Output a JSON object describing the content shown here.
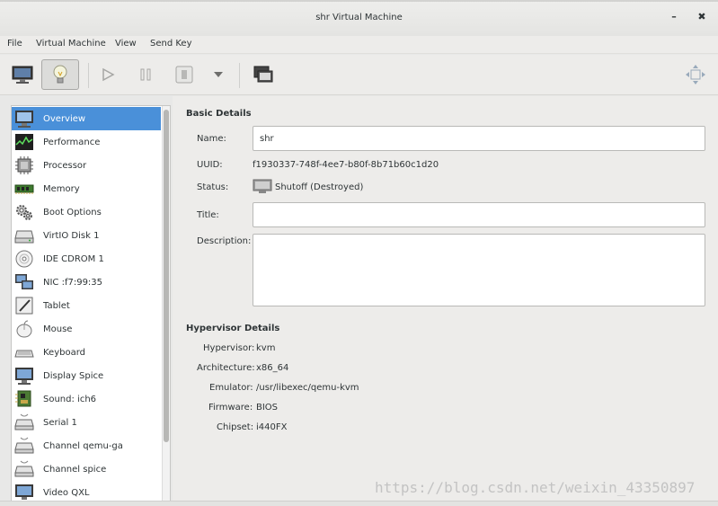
{
  "window": {
    "title": "shr Virtual Machine",
    "minimize_glyph": "–",
    "close_glyph": "✖"
  },
  "menu": [
    "File",
    "Virtual Machine",
    "View",
    "Send Key"
  ],
  "toolbar": {
    "buttons": [
      "console-monitor-icon",
      "details-lightbulb-icon",
      "run-play-icon",
      "pause-icon",
      "shutdown-icon",
      "shutdown-dropdown-icon",
      "snapshots-icon",
      "fullscreen-resize-icon"
    ]
  },
  "sidebar": {
    "items": [
      {
        "label": "Overview",
        "icon": "overview-monitor-icon",
        "selected": true
      },
      {
        "label": "Performance",
        "icon": "performance-graph-icon"
      },
      {
        "label": "Processor",
        "icon": "processor-chip-icon"
      },
      {
        "label": "Memory",
        "icon": "memory-ram-icon"
      },
      {
        "label": "Boot Options",
        "icon": "boot-gears-icon"
      },
      {
        "label": "VirtIO Disk 1",
        "icon": "disk-icon"
      },
      {
        "label": "IDE CDROM 1",
        "icon": "cdrom-icon"
      },
      {
        "label": "NIC :f7:99:35",
        "icon": "network-icon"
      },
      {
        "label": "Tablet",
        "icon": "tablet-icon"
      },
      {
        "label": "Mouse",
        "icon": "mouse-icon"
      },
      {
        "label": "Keyboard",
        "icon": "keyboard-icon"
      },
      {
        "label": "Display Spice",
        "icon": "display-icon"
      },
      {
        "label": "Sound: ich6",
        "icon": "sound-card-icon"
      },
      {
        "label": "Serial 1",
        "icon": "serial-icon"
      },
      {
        "label": "Channel qemu-ga",
        "icon": "channel-icon"
      },
      {
        "label": "Channel spice",
        "icon": "channel-icon"
      },
      {
        "label": "Video QXL",
        "icon": "video-icon"
      }
    ]
  },
  "basic": {
    "title": "Basic Details",
    "name_label": "Name:",
    "name_value": "shr",
    "uuid_label": "UUID:",
    "uuid_value": "f1930337-748f-4ee7-b80f-8b71b60c1d20",
    "status_label": "Status:",
    "status_value": "Shutoff (Destroyed)",
    "title_label": "Title:",
    "title_value": "",
    "description_label": "Description:",
    "description_value": ""
  },
  "hypervisor": {
    "title": "Hypervisor Details",
    "hypervisor_label": "Hypervisor:",
    "hypervisor_value": "kvm",
    "arch_label": "Architecture:",
    "arch_value": "x86_64",
    "emulator_label": "Emulator:",
    "emulator_value": "/usr/libexec/qemu-kvm",
    "firmware_label": "Firmware:",
    "firmware_value": "BIOS",
    "chipset_label": "Chipset:",
    "chipset_value": "i440FX"
  },
  "watermark": "https://blog.csdn.net/weixin_43350897"
}
